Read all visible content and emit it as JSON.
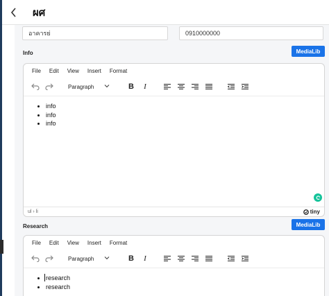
{
  "header": {
    "title": "ผศ",
    "back_icon": "chevron-left-icon"
  },
  "fields": {
    "building": "อาคารย่",
    "phone": "0910000000"
  },
  "sections": [
    {
      "label": "Info",
      "media_button": "MediaLib",
      "menu": [
        "File",
        "Edit",
        "View",
        "Insert",
        "Format"
      ],
      "block_format": "Paragraph",
      "items": [
        "info",
        "info",
        "info"
      ],
      "path": "ul › li",
      "brand": "tiny"
    },
    {
      "label": "Research",
      "media_button": "MediaLib",
      "menu": [
        "File",
        "Edit",
        "View",
        "Insert",
        "Format"
      ],
      "block_format": "Paragraph",
      "items": [
        "research",
        "research"
      ]
    }
  ],
  "colors": {
    "accent": "#1a73e8",
    "grammarly": "#15c39a",
    "sidebar": "#1f3b5c"
  }
}
